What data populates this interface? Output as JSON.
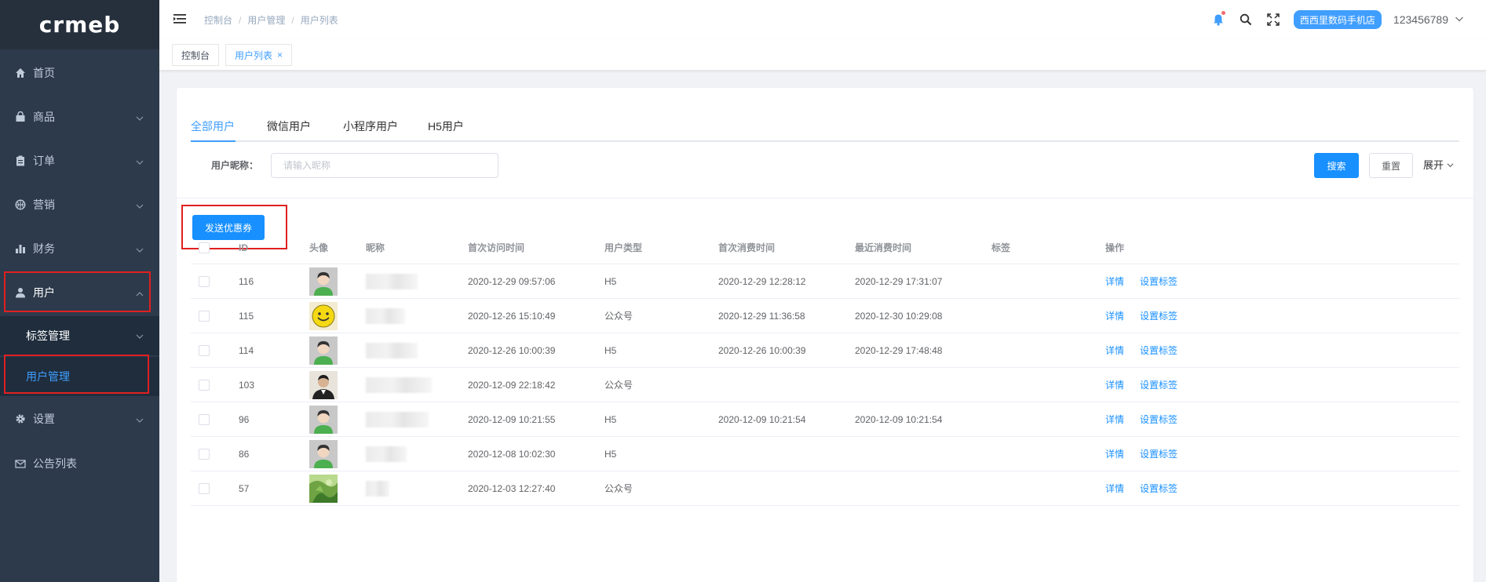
{
  "logo": {
    "text": "crmeb"
  },
  "sidebar": {
    "items": [
      {
        "label": "首页",
        "icon": "home-icon",
        "has_children": false
      },
      {
        "label": "商品",
        "icon": "bag-icon",
        "has_children": true
      },
      {
        "label": "订单",
        "icon": "clipboard-icon",
        "has_children": true
      },
      {
        "label": "营销",
        "icon": "basketball-icon",
        "has_children": true
      },
      {
        "label": "财务",
        "icon": "bar-chart-icon",
        "has_children": true
      },
      {
        "label": "用户",
        "icon": "user-icon",
        "has_children": true,
        "expanded": true
      },
      {
        "label": "设置",
        "icon": "gear-icon",
        "has_children": true
      },
      {
        "label": "公告列表",
        "icon": "mail-icon",
        "has_children": false
      }
    ],
    "sub_items": [
      {
        "label": "标签管理",
        "has_children": true
      },
      {
        "label": "用户管理",
        "selected": true
      }
    ]
  },
  "header": {
    "breadcrumb": [
      "控制台",
      "用户管理",
      "用户列表"
    ],
    "store_name": "西西里数码手机店",
    "username": "123456789"
  },
  "tags_view": [
    {
      "label": "控制台",
      "active": false
    },
    {
      "label": "用户列表",
      "active": true,
      "close": "×"
    }
  ],
  "tabs": [
    "全部用户",
    "微信用户",
    "小程序用户",
    "H5用户"
  ],
  "filter": {
    "label": "用户昵称：",
    "placeholder": "请输入昵称",
    "search_label": "搜索",
    "reset_label": "重置",
    "expand_label": "展开"
  },
  "send_coupon_label": "发送优惠券",
  "table": {
    "columns": [
      "ID",
      "头像",
      "昵称",
      "首次访问时间",
      "用户类型",
      "首次消费时间",
      "最近消费时间",
      "标签",
      "操作"
    ],
    "rows": [
      {
        "id": "116",
        "avatar": "default",
        "first_visit": "2020-12-29 09:57:06",
        "type": "H5",
        "first_pay": "2020-12-29 12:28:12",
        "last_pay": "2020-12-29 17:31:07"
      },
      {
        "id": "115",
        "avatar": "smiley",
        "first_visit": "2020-12-26 15:10:49",
        "type": "公众号",
        "first_pay": "2020-12-29 11:36:58",
        "last_pay": "2020-12-30 10:29:08"
      },
      {
        "id": "114",
        "avatar": "default",
        "first_visit": "2020-12-26 10:00:39",
        "type": "H5",
        "first_pay": "2020-12-26 10:00:39",
        "last_pay": "2020-12-29 17:48:48"
      },
      {
        "id": "103",
        "avatar": "photo-man",
        "first_visit": "2020-12-09 22:18:42",
        "type": "公众号",
        "first_pay": "",
        "last_pay": ""
      },
      {
        "id": "96",
        "avatar": "default",
        "first_visit": "2020-12-09 10:21:55",
        "type": "H5",
        "first_pay": "2020-12-09 10:21:54",
        "last_pay": "2020-12-09 10:21:54"
      },
      {
        "id": "86",
        "avatar": "default",
        "first_visit": "2020-12-08 10:02:30",
        "type": "H5",
        "first_pay": "",
        "last_pay": ""
      },
      {
        "id": "57",
        "avatar": "photo-green",
        "first_visit": "2020-12-03 12:27:40",
        "type": "公众号",
        "first_pay": "",
        "last_pay": ""
      }
    ],
    "action_detail": "详情",
    "action_tag": "设置标签"
  },
  "colors": {
    "primary": "#1890ff",
    "sidebar_bg": "#2d3a4b",
    "highlight_box": "#e02020"
  }
}
